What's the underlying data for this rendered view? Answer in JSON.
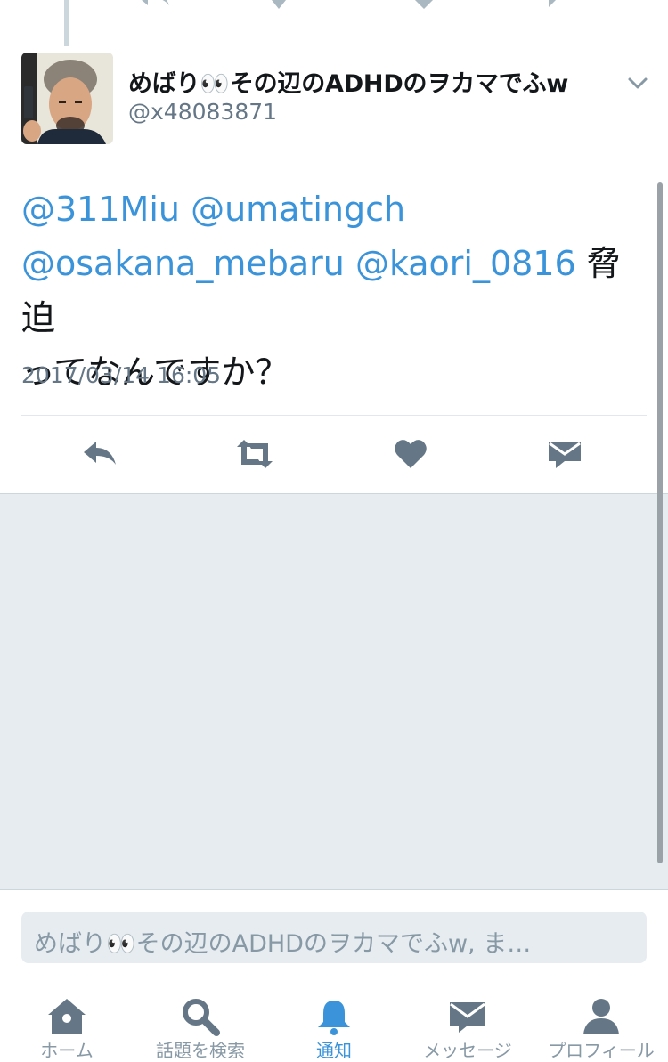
{
  "tweet": {
    "display_name": "めばり👀その辺のADHDのヲカマでふw",
    "handle": "@x48083871",
    "mentions": [
      "@311Miu",
      "@umatingch",
      "@osakana_mebaru",
      "@kaori_0816"
    ],
    "text_line2_tail": "脅迫",
    "text_line3": "ってなんですか？",
    "timestamp": "2017/03/14 16:05"
  },
  "reply": {
    "placeholder": "めばり👀その辺のADHDのヲカマでふw, ま…"
  },
  "tabs": [
    {
      "label": "ホーム",
      "icon": "home-icon"
    },
    {
      "label": "話題を検索",
      "icon": "search-icon"
    },
    {
      "label": "通知",
      "icon": "bell-icon",
      "active": true
    },
    {
      "label": "メッセージ",
      "icon": "mail-icon"
    },
    {
      "label": "プロフィール",
      "icon": "profile-icon"
    }
  ],
  "colors": {
    "accent": "#3b94d9",
    "icon_gray": "#657786",
    "secondary_text": "#657786",
    "background_gray": "#e6ecf0"
  }
}
